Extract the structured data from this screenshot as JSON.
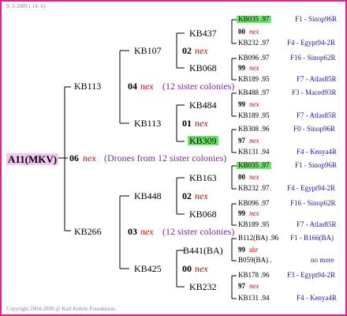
{
  "header_date": "9. 3-2009 ( 14: 6)",
  "footer": "Copyright 2004-2009 @ Karl Kehrle Foundation.",
  "root": "A11(MKV)",
  "gen1": {
    "queen": "06",
    "status": "nex",
    "note": "(Drones from 12 sister colonies)"
  },
  "kb113": {
    "name": "KB113",
    "queen": "04",
    "status": "nex",
    "note": "(12 sister colonies)"
  },
  "kb266": {
    "name": "KB266",
    "queen": "03",
    "status": "nex",
    "note": "(12 sister colonies)"
  },
  "kb107": {
    "name": "KB107",
    "queen": "02",
    "status": "nex"
  },
  "kb113b": {
    "name": "KB113",
    "queen": "01",
    "status": "nex"
  },
  "kb448": {
    "name": "KB448",
    "queen": "02",
    "status": "nex"
  },
  "kb425": {
    "name": "KB425",
    "queen": "00",
    "status": "nex"
  },
  "g4": [
    {
      "name": "KB437",
      "queen": "00",
      "status": "nex",
      "p1": "KB035 .97",
      "p1loc": "F1 - Sinop96R",
      "p2": "KB232 .97",
      "p2loc": "F4 - Egypt94-2R"
    },
    {
      "name": "KB068",
      "queen": "99",
      "status": "nex",
      "p1": "KB096 .97",
      "p1loc": "F16 - Sinop62R",
      "p2": "KB189 .95",
      "p2loc": "F7 - Atlas85R"
    },
    {
      "name": "KB484",
      "queen": "99",
      "status": "nex",
      "p1": "KB488 .97",
      "p1loc": "F3 - Maced93R",
      "p2": "KB189 .95",
      "p2loc": "F7 - Atlas85R"
    },
    {
      "name": "KB309",
      "queen": "97",
      "status": "nex",
      "p1": "KB308 .96",
      "p1loc": "F0 - Sinop96R",
      "p2": "KB131 .94",
      "p2loc": "F4 - Kenya4R"
    },
    {
      "name": "KB163",
      "queen": "00",
      "status": "nex",
      "p1": "KB035 .97",
      "p1loc": "F1 - Sinop96R",
      "p2": "KB232 .97",
      "p2loc": "F4 - Egypt94-2R"
    },
    {
      "name": "KB068",
      "queen": "99",
      "status": "nex",
      "p1": "KB096 .97",
      "p1loc": "F16 - Sinop62R",
      "p2": "KB189 .95",
      "p2loc": "F7 - Atlas85R"
    },
    {
      "name": "B441(BA)",
      "queen": "99",
      "status": "shr",
      "p1": "B112(BA) .96",
      "p1loc": "F1 - B166(BA)",
      "p2": "B059(BA) .",
      "p2loc": "no more"
    },
    {
      "name": "KB232",
      "queen": "97",
      "status": "nex",
      "p1": "KB178 .96",
      "p1loc": "F3 - Egypt94-2R",
      "p2": "KB131 .94",
      "p2loc": "F4 - Kenya4R"
    }
  ]
}
